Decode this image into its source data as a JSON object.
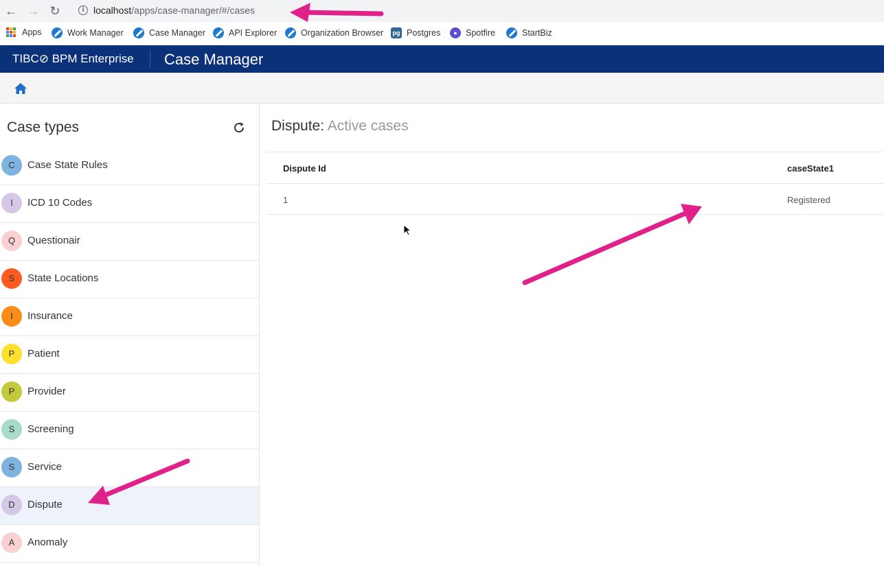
{
  "browser": {
    "url_host": "localhost",
    "url_path": "/apps/case-manager/#/cases",
    "bookmarks": [
      {
        "label": "Apps",
        "icon": "apps-grid-icon"
      },
      {
        "label": "Work Manager",
        "icon": "tibco-icon"
      },
      {
        "label": "Case Manager",
        "icon": "tibco-icon"
      },
      {
        "label": "API Explorer",
        "icon": "tibco-icon"
      },
      {
        "label": "Organization Browser",
        "icon": "tibco-icon"
      },
      {
        "label": "Postgres",
        "icon": "postgres-icon"
      },
      {
        "label": "Spotfire",
        "icon": "spotfire-icon"
      },
      {
        "label": "StartBiz",
        "icon": "tibco-icon"
      }
    ],
    "postgres_badge": "pg"
  },
  "header": {
    "brand": "TIBC⊘ BPM Enterprise",
    "title": "Case Manager"
  },
  "sidebar": {
    "title": "Case types",
    "items": [
      {
        "initial": "C",
        "label": "Case State Rules",
        "color": "#7eb3e0"
      },
      {
        "initial": "I",
        "label": "ICD 10 Codes",
        "color": "#d5c8e6"
      },
      {
        "initial": "Q",
        "label": "Questionair",
        "color": "#f9d1d1"
      },
      {
        "initial": "S",
        "label": "State Locations",
        "color": "#ff5a1f"
      },
      {
        "initial": "I",
        "label": "Insurance",
        "color": "#fb8c1a"
      },
      {
        "initial": "P",
        "label": "Patient",
        "color": "#fde12d"
      },
      {
        "initial": "P",
        "label": "Provider",
        "color": "#c2c93a"
      },
      {
        "initial": "S",
        "label": "Screening",
        "color": "#a7dcc9"
      },
      {
        "initial": "S",
        "label": "Service",
        "color": "#7eb3e0"
      },
      {
        "initial": "D",
        "label": "Dispute",
        "color": "#d5c8e6"
      },
      {
        "initial": "A",
        "label": "Anomaly",
        "color": "#f9d1d1"
      }
    ]
  },
  "main": {
    "case_type": "Dispute:",
    "subtitle": "Active cases",
    "columns": [
      "Dispute Id",
      "caseState1"
    ],
    "rows": [
      [
        "1",
        "Registered"
      ]
    ]
  },
  "colors": {
    "header_bg": "#0b3179",
    "annotation_arrow": "#e0218a",
    "selected_row": "#eef3fb"
  }
}
